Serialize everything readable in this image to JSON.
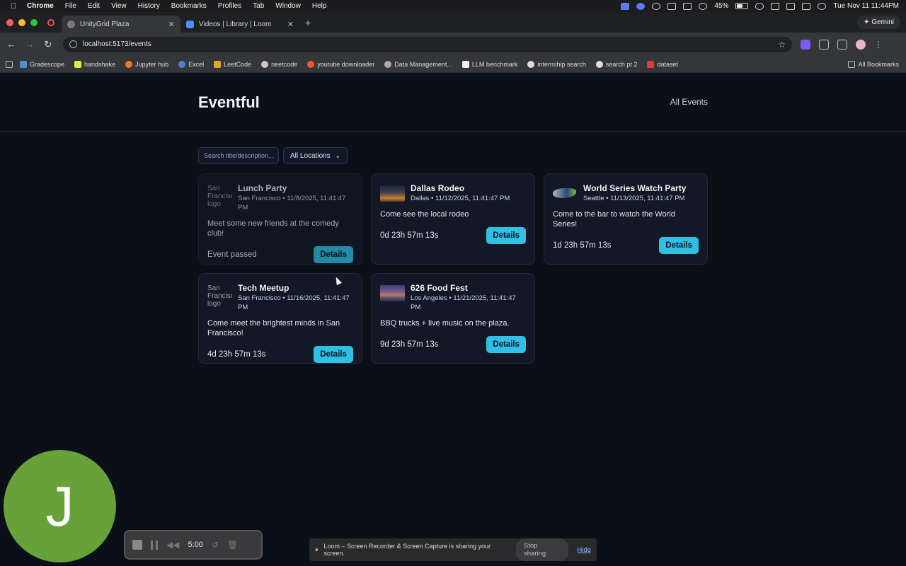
{
  "menubar": {
    "items": [
      "Chrome",
      "File",
      "Edit",
      "View",
      "History",
      "Bookmarks",
      "Profiles",
      "Tab",
      "Window",
      "Help"
    ],
    "battery": "45%",
    "clock": "Tue Nov 11  11:44PM"
  },
  "tabs": [
    {
      "title": "UnityGrid Plaza"
    },
    {
      "title": "Videos | Library | Loom"
    }
  ],
  "gemini_label": "Gemini",
  "address": "localhost:5173/events",
  "bookmarks": [
    "Gradescope",
    "handshake",
    "Jupyter hub",
    "Excel",
    "LeetCode",
    "neetcode",
    "youtube downloader",
    "Data Management...",
    "LLM benchmark",
    "internship search",
    "search pt 2",
    "dataset"
  ],
  "all_bookmarks": "All Bookmarks",
  "app": {
    "brand": "Eventful",
    "nav_all_events": "All Events",
    "search_placeholder": "Search title/description...",
    "location_select": "All Locations",
    "details_label": "Details",
    "events": [
      {
        "title": "Lunch Party",
        "meta": "San Francisco • 11/8/2025, 11:41:47 PM",
        "description": "Meet some new friends at the comedy club!",
        "status": "Event passed",
        "img_alt": "San Francisco logo"
      },
      {
        "title": "Dallas Rodeo",
        "meta": "Dallas • 11/12/2025, 11:41:47 PM",
        "description": "Come see the local rodeo",
        "status": "0d 23h 57m 13s"
      },
      {
        "title": "World Series Watch Party",
        "meta": "Seattle • 11/13/2025, 11:41:47 PM",
        "description": "Come to the bar to watch the World Series!",
        "status": "1d 23h 57m 13s"
      },
      {
        "title": "Tech Meetup",
        "meta": "San Francisco • 11/16/2025, 11:41:47 PM",
        "description": "Come meet the brightest minds in San Francisco!",
        "status": "4d 23h 57m 13s",
        "img_alt": "San Francisco logo"
      },
      {
        "title": "626 Food Fest",
        "meta": "Los Angeles • 11/21/2025, 11:41:47 PM",
        "description": "BBQ trucks + live music on the plaza.",
        "status": "9d 23h 57m 13s"
      }
    ]
  },
  "loom": {
    "avatar_letter": "J",
    "timer": "5:00",
    "share_text": "Loom – Screen Recorder & Screen Capture is sharing your screen.",
    "stop_sharing": "Stop sharing",
    "hide": "Hide"
  }
}
